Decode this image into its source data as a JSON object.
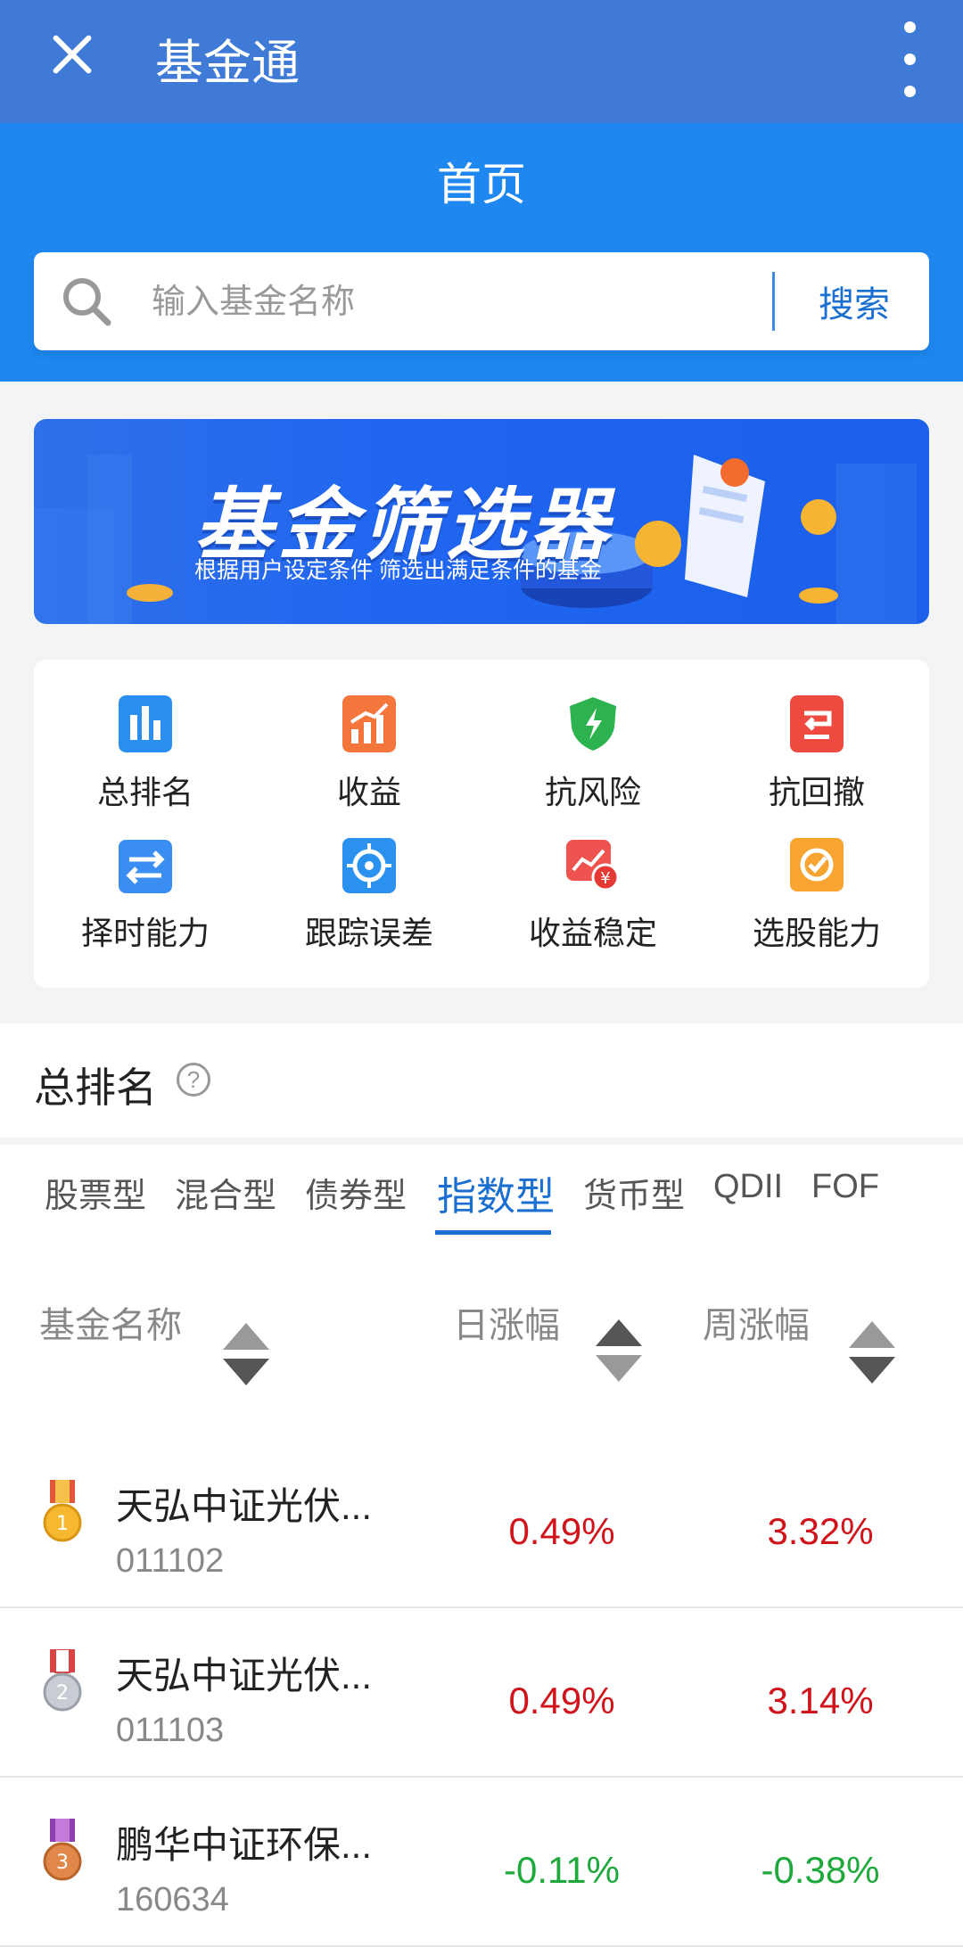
{
  "titlebar": {
    "title": "基金通"
  },
  "navbar": {
    "title": "首页"
  },
  "search": {
    "placeholder": "输入基金名称",
    "button": "搜索"
  },
  "banner": {
    "title": "基金筛选器",
    "subtitle": "根据用户设定条件 筛选出满足条件的基金"
  },
  "grid": [
    {
      "label": "总排名",
      "icon": "ranking-chart-icon",
      "color": "#2a8ff0"
    },
    {
      "label": "收益",
      "icon": "profit-bars-icon",
      "color": "#f5763c"
    },
    {
      "label": "抗风险",
      "icon": "shield-icon",
      "color": "#2cb34f"
    },
    {
      "label": "抗回撤",
      "icon": "drawdown-icon",
      "color": "#ee4a3f"
    },
    {
      "label": "择时能力",
      "icon": "timing-switch-icon",
      "color": "#3a8ef2"
    },
    {
      "label": "跟踪误差",
      "icon": "target-icon",
      "color": "#2a92ee"
    },
    {
      "label": "收益稳定",
      "icon": "stable-yield-icon",
      "color": "#ef5350"
    },
    {
      "label": "选股能力",
      "icon": "stock-pick-icon",
      "color": "#f7a431"
    }
  ],
  "section": {
    "title": "总排名",
    "help": "?"
  },
  "tabs": [
    "股票型",
    "混合型",
    "债券型",
    "指数型",
    "货币型",
    "QDII",
    "FOF"
  ],
  "active_tab": "指数型",
  "table": {
    "headers": [
      "基金名称",
      "日涨幅",
      "周涨幅"
    ],
    "rows": [
      {
        "medal": "gold-medal-icon",
        "name": "天弘中证光伏...",
        "code": "011102",
        "day": "0.49%",
        "week": "3.32%"
      },
      {
        "medal": "silver-medal-icon",
        "name": "天弘中证光伏...",
        "code": "011103",
        "day": "0.49%",
        "week": "3.14%"
      },
      {
        "medal": "bronze-medal-icon",
        "name": "鹏华中证环保...",
        "code": "160634",
        "day": "-0.11%",
        "week": "-0.38%"
      }
    ]
  }
}
